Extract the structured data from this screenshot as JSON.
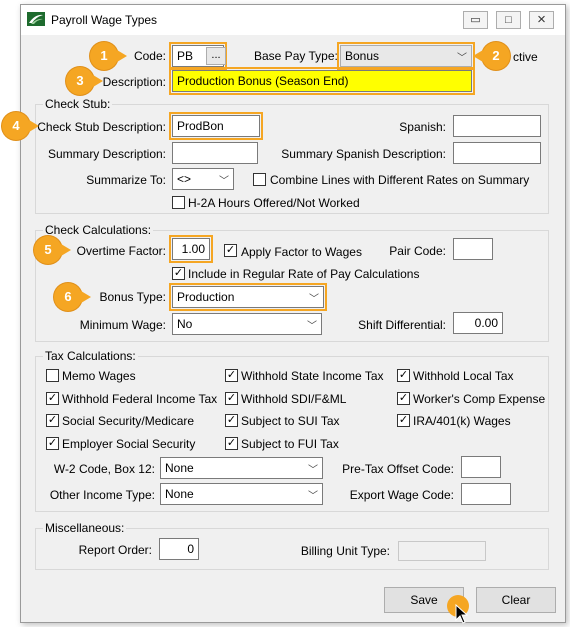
{
  "window": {
    "title": "Payroll Wage Types",
    "controls": {
      "minimize": "▭",
      "maximize": "□",
      "close": "×"
    }
  },
  "header": {
    "code_label": "Code:",
    "code_value": "PB",
    "code_button": "...",
    "base_pay_type_label": "Base Pay Type:",
    "base_pay_type_value": "Bonus",
    "inactive_label": "ctive",
    "description_label": "Description:",
    "description_value": "Production Bonus (Season End)"
  },
  "check_stub": {
    "title": "Check Stub:",
    "description_label": "Check Stub Description:",
    "description_value": "ProdBon",
    "spanish_label": "Spanish:",
    "spanish_value": "",
    "summary_label": "Summary Description:",
    "summary_value": "",
    "summary_spanish_label": "Summary Spanish Description:",
    "summary_spanish_value": "",
    "summarize_to_label": "Summarize To:",
    "summarize_to_value": "<>",
    "combine_lines_label": "Combine Lines with Different Rates on Summary",
    "h2a_label": "H-2A Hours Offered/Not Worked"
  },
  "check_calc": {
    "title": "Check Calculations:",
    "overtime_factor_label": "Overtime Factor:",
    "overtime_factor_value": "1.00",
    "apply_factor_label": "Apply Factor to Wages",
    "pair_code_label": "Pair Code:",
    "pair_code_value": "",
    "include_regular_label": "Include in Regular Rate of Pay Calculations",
    "bonus_type_label": "Bonus Type:",
    "bonus_type_value": "Production",
    "minimum_wage_label": "Minimum Wage:",
    "minimum_wage_value": "No",
    "shift_diff_label": "Shift Differential:",
    "shift_diff_value": "0.00"
  },
  "tax_calc": {
    "title": "Tax Calculations:",
    "checkboxes": [
      {
        "label": "Memo Wages",
        "checked": false
      },
      {
        "label": "Withhold State Income Tax",
        "checked": true
      },
      {
        "label": "Withhold Local Tax",
        "checked": true
      },
      {
        "label": "Withhold Federal Income Tax",
        "checked": true
      },
      {
        "label": "Withhold SDI/F&ML",
        "checked": true
      },
      {
        "label": "Worker's Comp Expense",
        "checked": true
      },
      {
        "label": "Social Security/Medicare",
        "checked": true
      },
      {
        "label": "Subject to SUI Tax",
        "checked": true
      },
      {
        "label": "IRA/401(k) Wages",
        "checked": true
      },
      {
        "label": "Employer Social Security",
        "checked": true
      },
      {
        "label": "Subject to FUI Tax",
        "checked": true
      }
    ],
    "w2_label": "W-2 Code, Box 12:",
    "w2_value": "None",
    "pretax_label": "Pre-Tax Offset Code:",
    "pretax_value": "",
    "other_income_label": "Other Income Type:",
    "other_income_value": "None",
    "export_wage_label": "Export Wage Code:",
    "export_wage_value": ""
  },
  "misc": {
    "title": "Miscellaneous:",
    "report_order_label": "Report Order:",
    "report_order_value": "0",
    "billing_unit_label": "Billing Unit Type:",
    "billing_unit_value": ""
  },
  "footer": {
    "save_label": "Save",
    "clear_label": "Clear"
  },
  "callouts": [
    "1",
    "2",
    "3",
    "4",
    "5",
    "6"
  ],
  "colors": {
    "highlight": "#f5a623",
    "description_fill": "#ffff00"
  }
}
